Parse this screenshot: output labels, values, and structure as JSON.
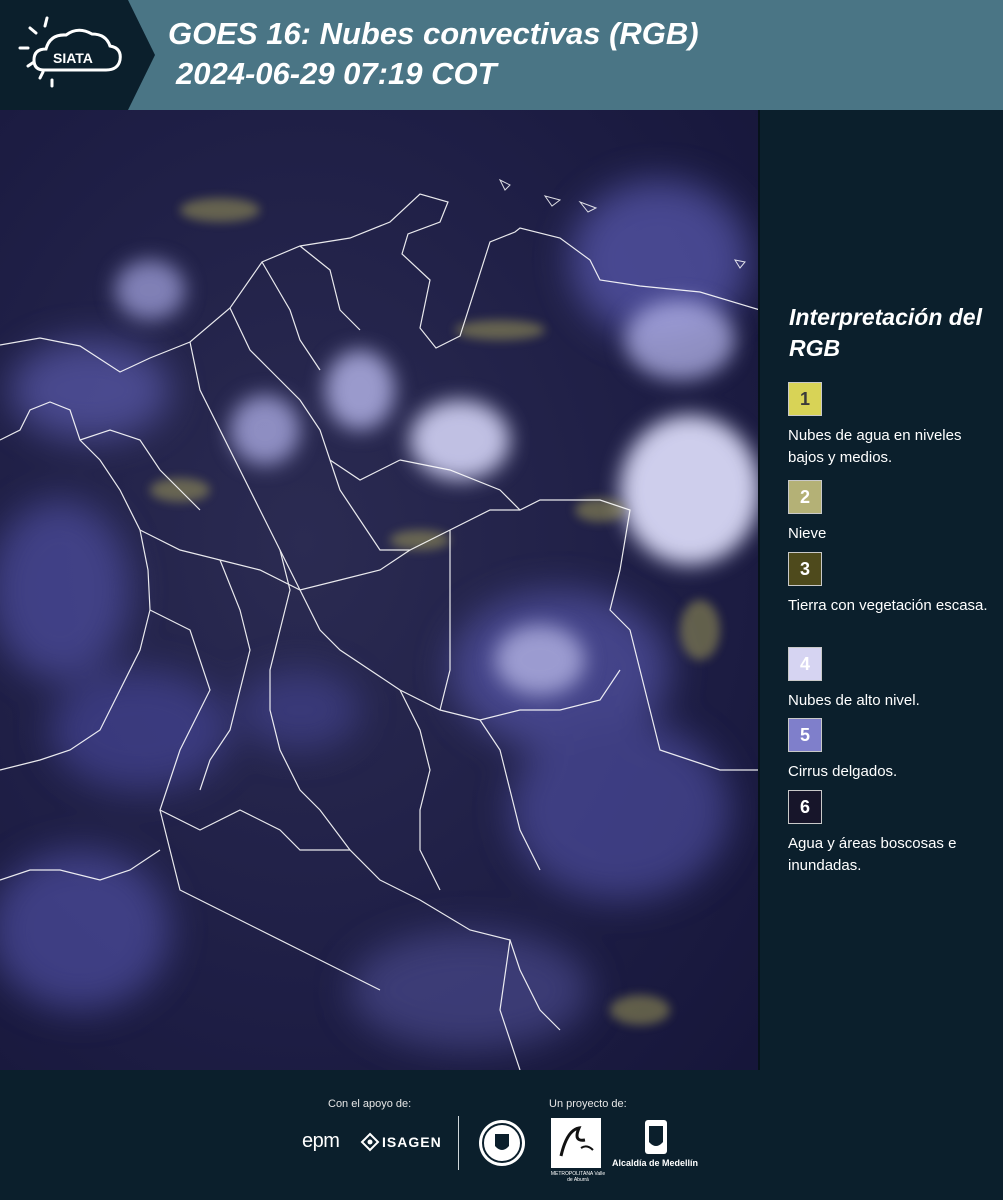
{
  "header": {
    "logo_text": "SIATA",
    "title_line1": "GOES 16: Nubes convectivas (RGB)",
    "title_line2": "2024-06-29 07:19 COT"
  },
  "map": {
    "icon": "satellite-rgb-map"
  },
  "legend": {
    "title": "Interpretación del RGB",
    "items": [
      {
        "number": "1",
        "color": "#d8d356",
        "text": "Nubes de agua en niveles bajos y medios."
      },
      {
        "number": "2",
        "color": "#b4b176",
        "text": "Nieve"
      },
      {
        "number": "3",
        "color": "#4e4a1c",
        "text": "Tierra con vegetación escasa."
      },
      {
        "number": "4",
        "color": "#d6d4f2",
        "text": "Nubes de alto nivel."
      },
      {
        "number": "5",
        "color": "#7f7fcb",
        "text": "Cirrus delgados."
      },
      {
        "number": "6",
        "color": "#17152a",
        "text": "Agua y áreas boscosas e inundadas."
      }
    ]
  },
  "footer": {
    "support_label": "Con el apoyo de:",
    "project_label": "Un proyecto de:",
    "epm": "epm",
    "isagen": "ISAGEN",
    "amva_text": "METROPOLITANA Valle de Aburrá",
    "alcaldia": "Alcaldía de Medellín"
  }
}
